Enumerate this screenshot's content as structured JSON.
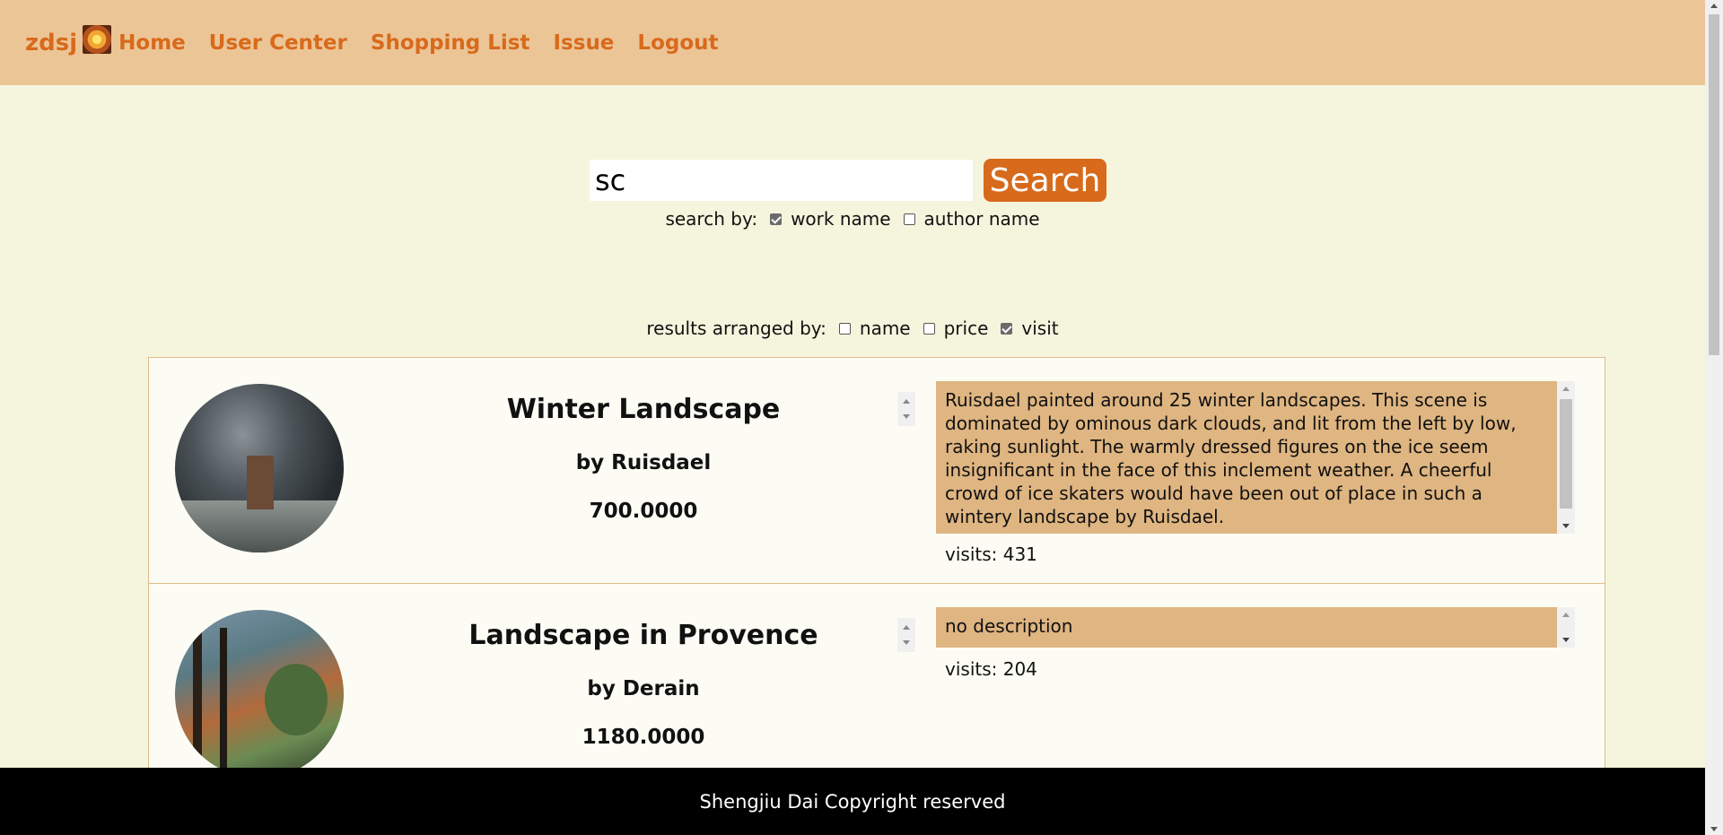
{
  "header": {
    "brand": "zdsj",
    "nav": [
      "Home",
      "User Center",
      "Shopping List",
      "Issue",
      "Logout"
    ]
  },
  "search": {
    "value": "sc",
    "button": "Search",
    "by_label": "search by:",
    "options": [
      {
        "label": "work name",
        "checked": true
      },
      {
        "label": "author name",
        "checked": false
      }
    ]
  },
  "arrange": {
    "label": "results arranged by:",
    "options": [
      {
        "label": "name",
        "checked": false
      },
      {
        "label": "price",
        "checked": false
      },
      {
        "label": "visit",
        "checked": true
      }
    ]
  },
  "results": [
    {
      "name": "Winter Landscape",
      "author": "by Ruisdael",
      "price": "700.0000",
      "description": "Ruisdael painted around 25 winter landscapes. This scene is dominated by ominous dark clouds, and lit from the left by low, raking sunlight. The warmly dressed figures on the ice seem insignificant in the face of this inclement weather. A cheerful crowd of ice skaters would have been out of place in such a wintery landscape by Ruisdael.",
      "visits": "visits: 431"
    },
    {
      "name": "Landscape in Provence",
      "author": "by Derain",
      "price": "1180.0000",
      "description": "no description",
      "visits": "visits: 204"
    }
  ],
  "footer": {
    "text": "Shengjiu Dai Copyright reserved"
  },
  "colors": {
    "header_bg": "#ecc596",
    "accent": "#d86a1c",
    "page_bg": "#f5f5de",
    "desc_bg": "#dfb581"
  }
}
